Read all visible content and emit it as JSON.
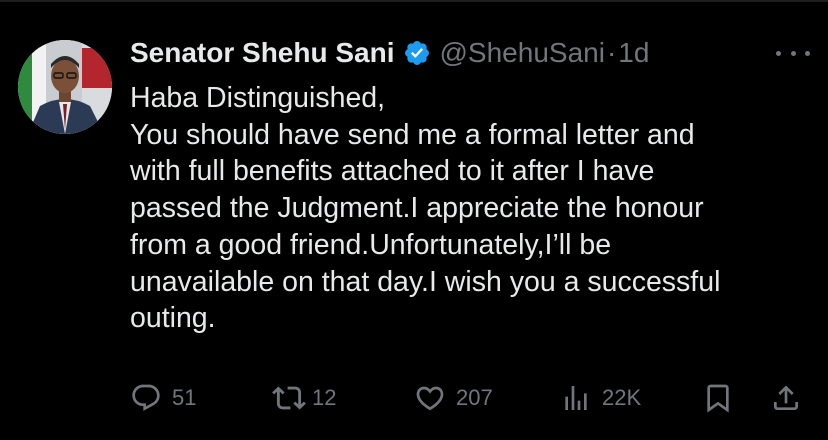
{
  "tweet": {
    "author": {
      "display_name": "Senator Shehu Sani",
      "handle": "@ShehuSani",
      "separator": "·",
      "time": "1d",
      "verified": true,
      "verified_color": "#1d9bf0"
    },
    "text_lines": [
      "Haba Distinguished,",
      "You should have send me a formal letter and",
      "with full benefits attached to it after I have",
      "passed the Judgment.I appreciate the honour",
      "from a good friend.Unfortunately,I’ll be",
      "unavailable on that day.I wish you a successful",
      "outing."
    ],
    "actions": {
      "reply": {
        "icon": "reply-icon",
        "count": "51"
      },
      "retweet": {
        "icon": "retweet-icon",
        "count": "12"
      },
      "like": {
        "icon": "heart-icon",
        "count": "207"
      },
      "views": {
        "icon": "views-icon",
        "count": "22K"
      },
      "bookmark": {
        "icon": "bookmark-icon"
      },
      "share": {
        "icon": "share-icon"
      }
    }
  },
  "colors": {
    "background": "#000000",
    "text_primary": "#e7e9ea",
    "text_secondary": "#71767b"
  }
}
